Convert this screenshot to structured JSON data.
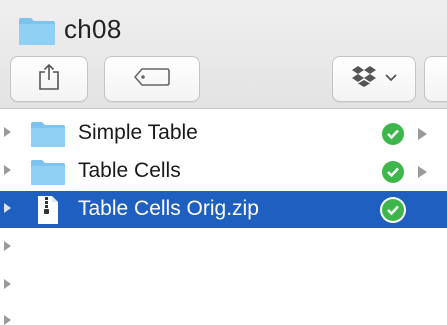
{
  "window": {
    "title": "ch08",
    "title_icon": "folder-icon"
  },
  "toolbar": {
    "buttons": [
      {
        "name": "share-button",
        "icon": "share-icon"
      },
      {
        "name": "tags-button",
        "icon": "tag-icon"
      },
      {
        "name": "dropbox-button",
        "icon": "dropbox-icon",
        "has_dropdown": true
      }
    ]
  },
  "files": [
    {
      "label": "Simple Table",
      "icon": "folder-icon",
      "status": "synced",
      "selected": false
    },
    {
      "label": "Table Cells",
      "icon": "folder-icon",
      "status": "synced",
      "selected": false
    },
    {
      "label": "Table Cells Orig.zip",
      "icon": "zip-file-icon",
      "status": "synced",
      "selected": true
    }
  ],
  "colors": {
    "selection": "#1f5fbf",
    "folder": "#7cc4ee",
    "synced": "#3fb64b"
  }
}
